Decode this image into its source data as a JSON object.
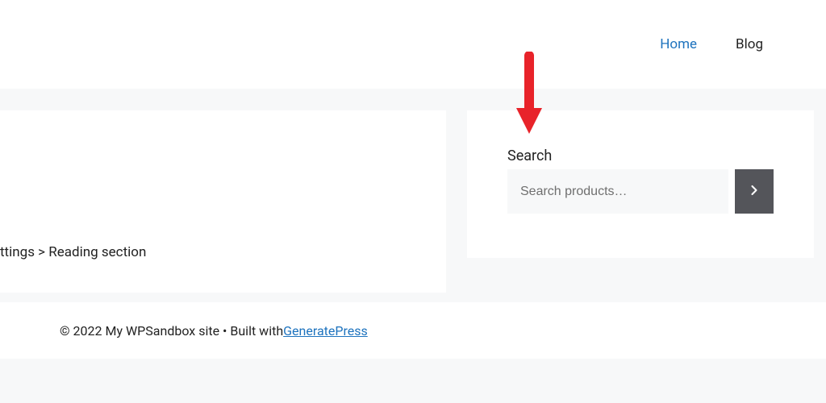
{
  "nav": {
    "home": "Home",
    "blog": "Blog"
  },
  "content": {
    "reading_section": "ttings > Reading section"
  },
  "sidebar": {
    "search_label": "Search",
    "search_placeholder": "Search products…"
  },
  "footer": {
    "copyright": "© 2022 My WPSandbox site • Built with ",
    "link_text": "GeneratePress"
  }
}
